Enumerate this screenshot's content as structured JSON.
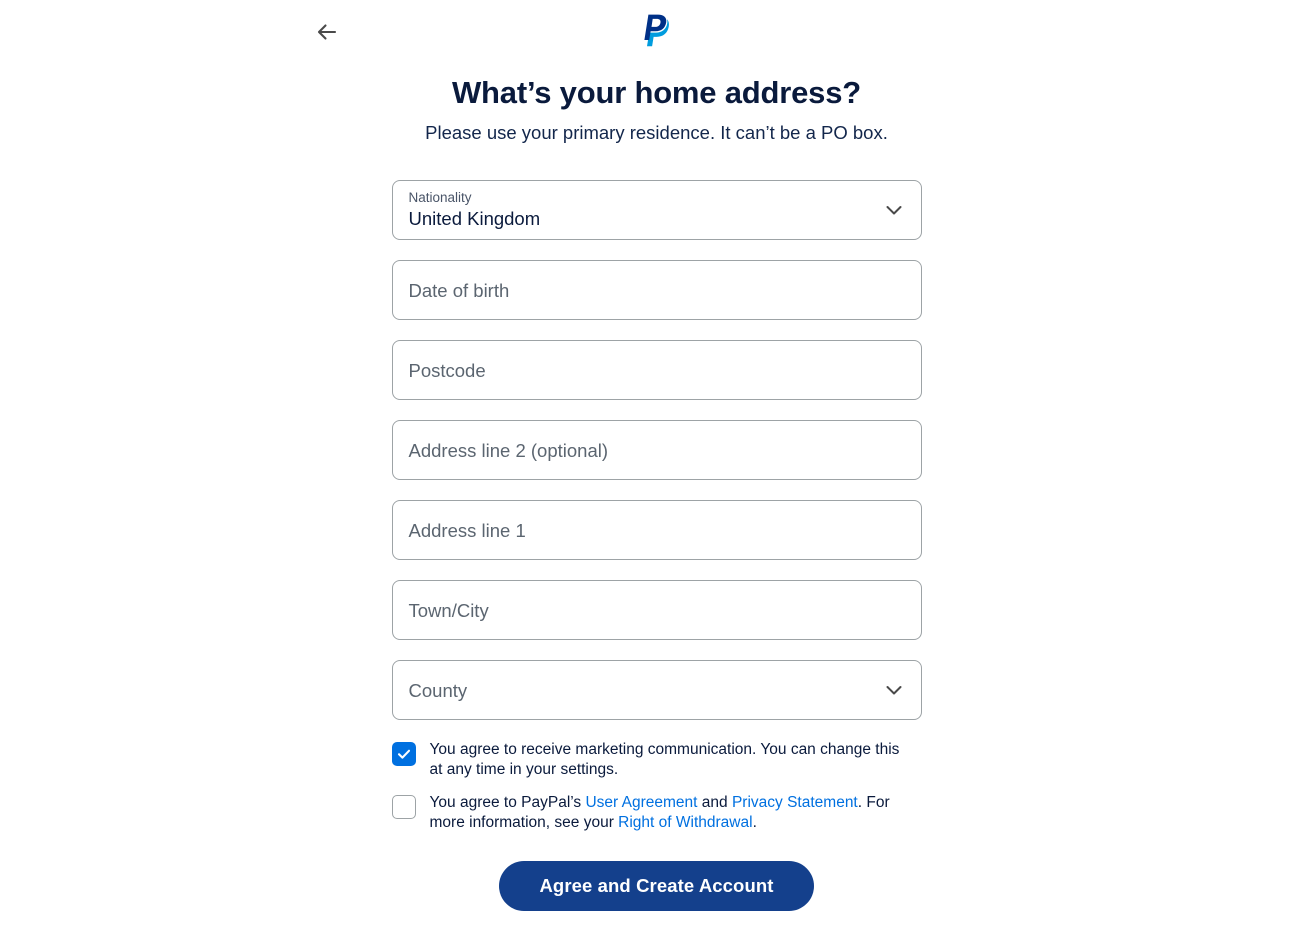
{
  "header": {
    "back_icon": "arrow-left-icon",
    "logo_icon": "paypal-logo"
  },
  "title": "What’s your home address?",
  "subtitle": "Please use your primary residence. It can’t be a PO box.",
  "form": {
    "nationality": {
      "label": "Nationality",
      "value": "United Kingdom",
      "icon": "chevron-down-icon"
    },
    "date_of_birth": {
      "placeholder": "Date of birth",
      "value": ""
    },
    "postcode": {
      "placeholder": "Postcode",
      "value": ""
    },
    "address_line_2": {
      "placeholder": "Address line 2 (optional)",
      "value": ""
    },
    "address_line_1": {
      "placeholder": "Address line 1",
      "value": ""
    },
    "town_city": {
      "placeholder": "Town/City",
      "value": ""
    },
    "county": {
      "placeholder": "County",
      "value": "",
      "icon": "chevron-down-icon"
    }
  },
  "consents": {
    "marketing": {
      "checked": true,
      "text": "You agree to receive marketing communication. You can change this at any time in your settings."
    },
    "terms": {
      "checked": false,
      "text_part_1": "You agree to PayPal’s ",
      "link_user_agreement": "User Agreement",
      "text_part_2": " and ",
      "link_privacy_statement": "Privacy Statement",
      "text_part_3": ". For more information, see your ",
      "link_right_of_withdrawal": "Right of Withdrawal",
      "text_part_4": "."
    }
  },
  "submit": {
    "label": "Agree and Create Account"
  },
  "colors": {
    "brand_navy": "#14408c",
    "link_blue": "#0070e0",
    "checkbox_blue": "#0070e0",
    "text_dark": "#0a1a3c",
    "border_gray": "#9da3a6"
  }
}
